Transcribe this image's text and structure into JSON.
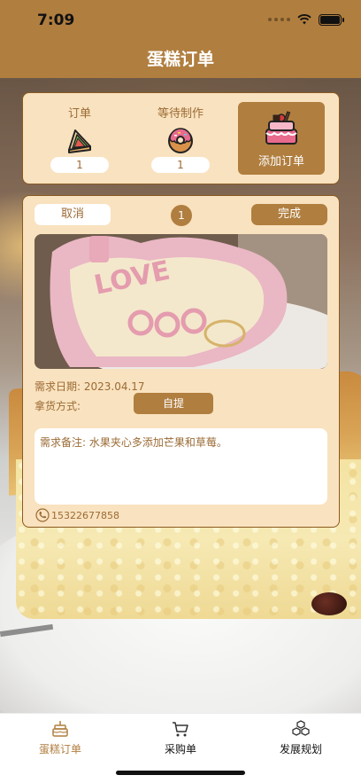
{
  "status_bar": {
    "time": "7:09"
  },
  "nav": {
    "title": "蛋糕订单"
  },
  "summary": {
    "orders": {
      "label": "订单",
      "count": "1",
      "icon": "sandwich-icon"
    },
    "waiting": {
      "label": "等待制作",
      "count": "1",
      "icon": "donut-icon"
    },
    "add_order": {
      "label": "添加订单",
      "icon": "cake-icon"
    }
  },
  "order": {
    "cancel_label": "取消",
    "index": "1",
    "done_label": "完成",
    "photo_icon": "cake-photo",
    "demand_date": "需求日期: 2023.04.17",
    "pickup_label": "拿货方式:",
    "pickup_value": "自提",
    "notes": "需求备注: 水果夹心多添加芒果和草莓。",
    "phone": "15322677858"
  },
  "tabs": [
    {
      "label": "蛋糕订单",
      "icon": "cake-tab-icon",
      "active": true
    },
    {
      "label": "采购单",
      "icon": "cart-icon",
      "active": false
    },
    {
      "label": "发展规划",
      "icon": "boxes-icon",
      "active": false
    }
  ],
  "colors": {
    "brand": "#b07e3f",
    "card_bg": "#f9e2bf",
    "text_brown": "#9b6b35"
  }
}
